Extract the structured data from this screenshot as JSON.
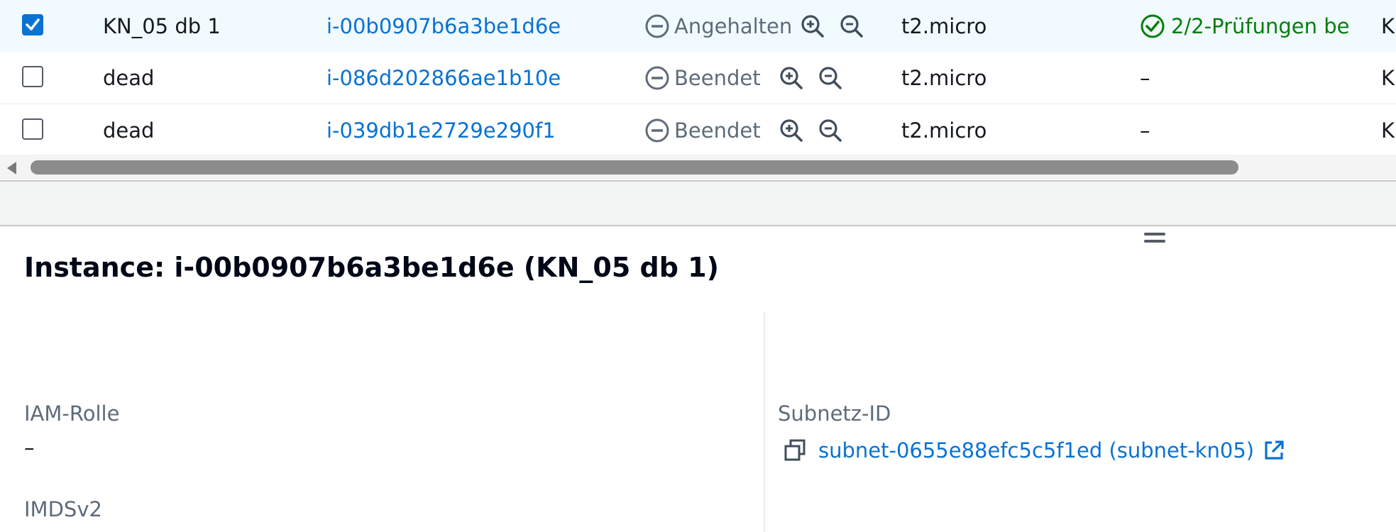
{
  "table": {
    "rows": [
      {
        "selected": true,
        "name": "KN_05 db 1",
        "instance_id": "i-00b0907b6a3be1d6e",
        "state": "Angehalten",
        "type": "t2.micro",
        "status_check": "2/2-Prüfungen be",
        "next": "K"
      },
      {
        "selected": false,
        "name": "dead",
        "instance_id": "i-086d202866ae1b10e",
        "state": "Beendet",
        "type": "t2.micro",
        "status_check": "–",
        "next": "K"
      },
      {
        "selected": false,
        "name": "dead",
        "instance_id": "i-039db1e2729e290f1",
        "state": "Beendet",
        "type": "t2.micro",
        "status_check": "–",
        "next": "K"
      }
    ]
  },
  "details": {
    "title": "Instance: i-00b0907b6a3be1d6e (KN_05 db 1)",
    "iam_label": "IAM-Rolle",
    "iam_value": "–",
    "imds_label": "IMDSv2",
    "subnet_label": "Subnetz-ID",
    "subnet_value": "subnet-0655e88efc5c5f1ed (subnet-kn05)"
  },
  "colors": {
    "link": "#0972d3",
    "success": "#037f0c",
    "muted": "#5f6b7a",
    "selected_row_bg": "#f1faff"
  },
  "icons": [
    "checkbox-checked-icon",
    "minus-circle-icon",
    "zoom-in-icon",
    "zoom-out-icon",
    "check-circle-icon",
    "scroll-left-icon",
    "copy-icon",
    "external-link-icon",
    "drag-handle-icon"
  ]
}
